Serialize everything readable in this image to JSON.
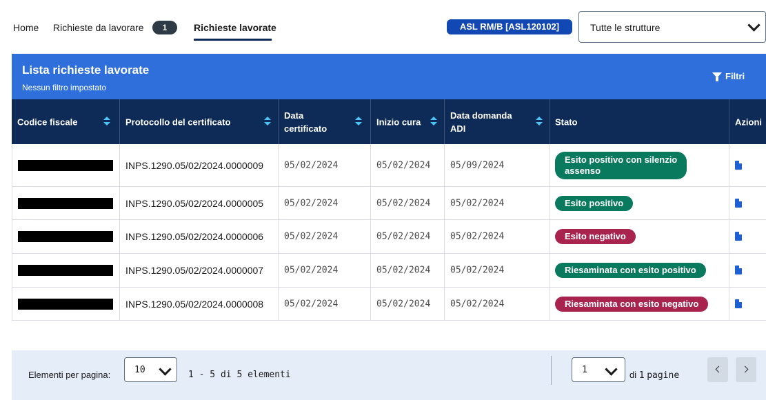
{
  "nav": {
    "home": "Home",
    "todo": "Richieste da lavorare",
    "todo_count": "1",
    "done": "Richieste lavorate",
    "asl": "ASL RM/B [ASL120102]",
    "structures_select": "Tutte le strutture"
  },
  "panel": {
    "title": "Lista richieste lavorate",
    "subtitle": "Nessun filtro impostato",
    "filter_label": "Filtri"
  },
  "table": {
    "headers": {
      "codice_fiscale": "Codice fiscale",
      "protocollo": "Protocollo del certificato",
      "data_certificato_1": "Data",
      "data_certificato_2": "certificato",
      "inizio_cura": "Inizio cura",
      "data_domanda_1": "Data domanda",
      "data_domanda_2": "ADI",
      "stato": "Stato",
      "azioni": "Azioni"
    },
    "rows": [
      {
        "protocollo": "INPS.1290.05/02/2024.0000009",
        "data_certificato": "05/02/2024",
        "inizio_cura": "05/02/2024",
        "data_domanda": "05/09/2024",
        "stato_1": "Esito positivo con silenzio",
        "stato_2": "assenso",
        "stato_color": "#0a7a5e"
      },
      {
        "protocollo": "INPS.1290.05/02/2024.0000005",
        "data_certificato": "05/02/2024",
        "inizio_cura": "05/02/2024",
        "data_domanda": "05/02/2024",
        "stato_1": "Esito positivo",
        "stato_2": "",
        "stato_color": "#0a7a5e"
      },
      {
        "protocollo": "INPS.1290.05/02/2024.0000006",
        "data_certificato": "05/02/2024",
        "inizio_cura": "05/02/2024",
        "data_domanda": "05/02/2024",
        "stato_1": "Esito negativo",
        "stato_2": "",
        "stato_color": "#a8244f"
      },
      {
        "protocollo": "INPS.1290.05/02/2024.0000007",
        "data_certificato": "05/02/2024",
        "inizio_cura": "05/02/2024",
        "data_domanda": "05/02/2024",
        "stato_1": "Riesaminata con esito positivo",
        "stato_2": "",
        "stato_color": "#0a7a5e"
      },
      {
        "protocollo": "INPS.1290.05/02/2024.0000008",
        "data_certificato": "05/02/2024",
        "inizio_cura": "05/02/2024",
        "data_domanda": "05/02/2024",
        "stato_1": "Riesaminata con esito negativo",
        "stato_2": "",
        "stato_color": "#a8244f"
      }
    ]
  },
  "footer": {
    "per_page_label": "Elementi per pagina:",
    "per_page_value": "10",
    "range": "1 - 5 di 5 elementi",
    "page_value": "1",
    "page_suffix_di": "di",
    "page_total": "1",
    "page_suffix_pagine": "pagine"
  },
  "colors": {
    "header_blue": "#2f6fdb",
    "table_head_navy": "#0e2a57",
    "positive_green": "#0a7a5e",
    "negative_red": "#a8244f"
  },
  "icons": [
    "filter-icon",
    "sort-icon",
    "document-icon",
    "chevron-down-icon",
    "chevron-left-icon",
    "chevron-right-icon"
  ]
}
